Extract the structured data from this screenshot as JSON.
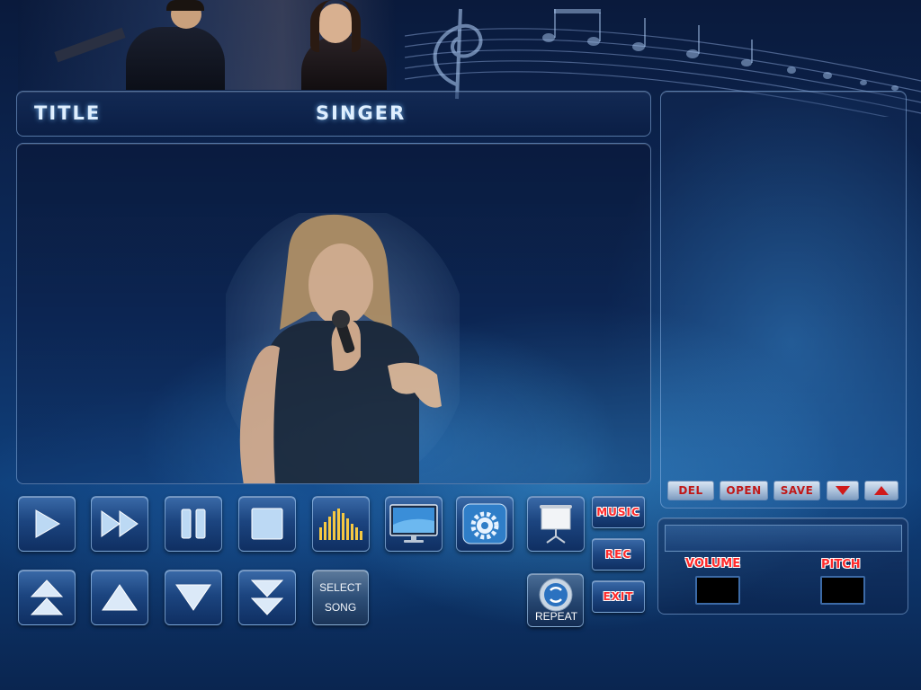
{
  "header": {
    "title_label": "TITLE",
    "singer_label": "SINGER"
  },
  "transport": {
    "play": "play-icon",
    "fast_forward": "fast-forward-icon",
    "pause": "pause-icon",
    "stop": "stop-icon",
    "equalizer": "equalizer-icon",
    "monitor": "monitor-icon",
    "settings": "gear-icon",
    "projector": "projector-screen-icon"
  },
  "nav": {
    "first": "double-up-arrow-icon",
    "up": "up-arrow-icon",
    "down": "down-arrow-icon",
    "last": "double-down-arrow-icon",
    "select_song_line1": "SELECT",
    "select_song_line2": "SONG"
  },
  "side_buttons": {
    "music": "MUSIC",
    "rec": "REC",
    "exit": "EXIT",
    "repeat": "REPEAT"
  },
  "playlist": {
    "del": "DEL",
    "open": "OPEN",
    "save": "SAVE"
  },
  "info": {
    "volume_label": "VOLUME",
    "pitch_label": "PITCH",
    "volume_value": "",
    "pitch_value": ""
  },
  "colors": {
    "accent_red": "#ff2a2a",
    "label_white": "#dfefff",
    "panel_border": "#8cb4e6"
  }
}
